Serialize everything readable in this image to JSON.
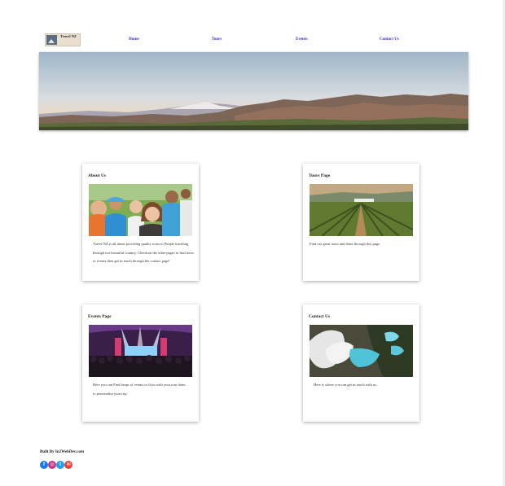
{
  "brand": {
    "logo_text": "Travel NZ"
  },
  "nav": {
    "items": [
      {
        "label": "Home"
      },
      {
        "label": "Tours"
      },
      {
        "label": "Events"
      },
      {
        "label": "Contact Us"
      }
    ]
  },
  "hero": {
    "image": "landscape-photo"
  },
  "cards": [
    {
      "title": "About Us",
      "image": "group-of-people-photo",
      "text": "Travel NZ is all about providing quality tours to People traveling through our beautiful country. Checkout the other pages to find tours or events then get in touch through the contact page!"
    },
    {
      "title": "Tours Page",
      "image": "vineyard-photo",
      "text": "Find our great tours and dates through this page"
    },
    {
      "title": "Events Page",
      "image": "concert-crowd-photo",
      "text": "Here you can Find heaps of events to fit in with your tour dates to personalise your trip"
    },
    {
      "title": "Contact Us",
      "image": "geothermal-pools-photo",
      "text": "Here is where you can get in touch with us."
    }
  ],
  "footer": {
    "built_by": "Built By In2WebDev.com",
    "social": [
      {
        "icon": "facebook-icon",
        "glyph": "f",
        "color": "#1877f2"
      },
      {
        "icon": "instagram-icon",
        "glyph": "◎",
        "color": "#c13584"
      },
      {
        "icon": "twitter-icon",
        "glyph": "t",
        "color": "#1da1f2"
      },
      {
        "icon": "email-icon",
        "glyph": "✉",
        "color": "#ea4335"
      }
    ]
  }
}
